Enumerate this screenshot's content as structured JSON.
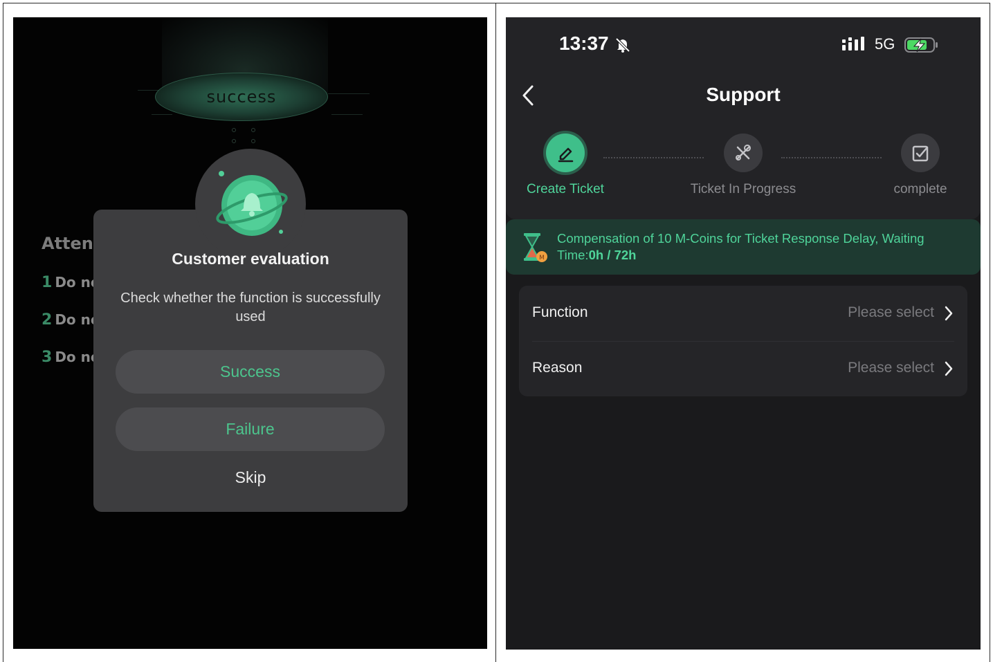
{
  "left": {
    "banner_text": "success",
    "attention_title": "Atten",
    "attention_items": [
      {
        "num": "1",
        "text": "Do no"
      },
      {
        "num": "2",
        "text": "Do no"
      },
      {
        "num": "3",
        "text": "Do no"
      }
    ],
    "modal": {
      "title": "Customer evaluation",
      "subtitle": "Check whether the function is successfully used",
      "success_label": "Success",
      "failure_label": "Failure",
      "skip_label": "Skip"
    }
  },
  "right": {
    "status_bar": {
      "time": "13:37",
      "network": "5G"
    },
    "title": "Support",
    "steps": [
      {
        "label": "Create Ticket",
        "icon": "pencil-icon",
        "active": true
      },
      {
        "label": "Ticket In Progress",
        "icon": "tools-icon",
        "active": false
      },
      {
        "label": "complete",
        "icon": "checkbox-icon",
        "active": false
      }
    ],
    "notice": {
      "text": "Compensation of 10 M-Coins for Ticket Response Delay, Waiting Time:",
      "highlight": "0h / 72h"
    },
    "form": {
      "function": {
        "label": "Function",
        "placeholder": "Please select"
      },
      "reason": {
        "label": "Reason",
        "placeholder": "Please select"
      }
    }
  },
  "colors": {
    "accent": "#3fbf8a",
    "accent_text": "#4cc58d",
    "modal_bg": "#3d3d3f",
    "notice_bg": "#1e3a31"
  }
}
